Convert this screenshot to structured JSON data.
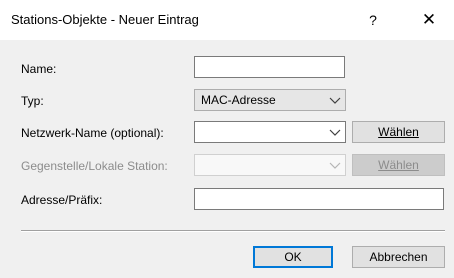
{
  "window": {
    "title": "Stations-Objekte - Neuer Eintrag",
    "help_glyph": "?",
    "close_glyph": "✕"
  },
  "form": {
    "name": {
      "label": "Name:",
      "value": ""
    },
    "typ": {
      "label": "Typ:",
      "value": "MAC-Adresse"
    },
    "netzwerk": {
      "label": "Netzwerk-Name (optional):",
      "value": "",
      "button": "Wählen"
    },
    "gegenstelle": {
      "label": "Gegenstelle/Lokale Station:",
      "value": "",
      "button": "Wählen",
      "disabled": true
    },
    "adresse": {
      "label": "Adresse/Präfix:",
      "value": ""
    }
  },
  "footer": {
    "ok": "OK",
    "cancel": "Abbrechen"
  },
  "icons": {
    "combo_arrow": "chevron-down-icon",
    "close": "close-icon",
    "help": "help-icon"
  },
  "colors": {
    "dialog_bg": "#f0f0f0",
    "focus_border": "#0078d7",
    "disabled_text": "#8c8c8c"
  }
}
